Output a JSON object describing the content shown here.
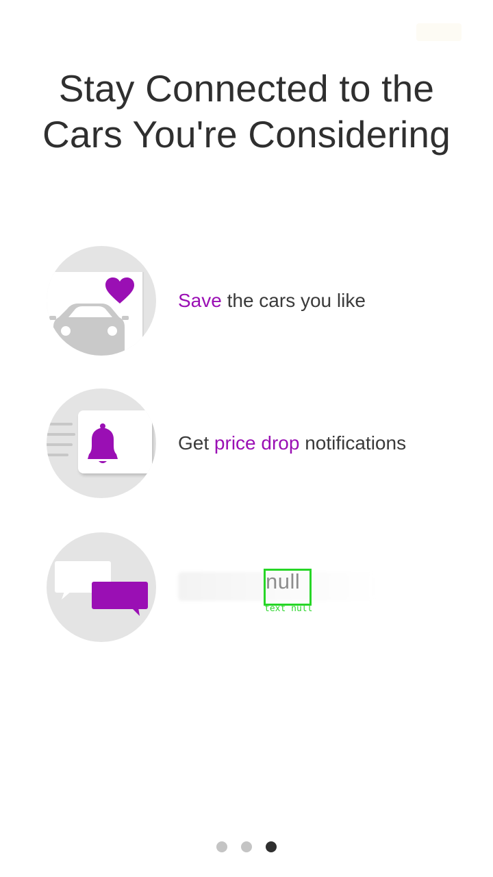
{
  "title": {
    "line1": "Stay Connected to the",
    "line2": "Cars You're Considering"
  },
  "features": [
    {
      "icon": "car-heart-icon",
      "accent": "Save",
      "rest": " the cars you like"
    },
    {
      "icon": "bell-notification-icon",
      "prefix": "Get ",
      "accent": "price drop",
      "suffix": " notifications"
    },
    {
      "icon": "chat-bubbles-icon",
      "text": "null",
      "overlay_label": "text null"
    }
  ],
  "pager": {
    "total": 3,
    "active_index": 2
  },
  "colors": {
    "accent": "#9a0fb4",
    "circle": "#e4e4e4",
    "title": "#2f2f2f",
    "dot_active": "#2f2f2f",
    "dot_inactive": "#c4c4c4",
    "debug_box": "#27d627"
  }
}
